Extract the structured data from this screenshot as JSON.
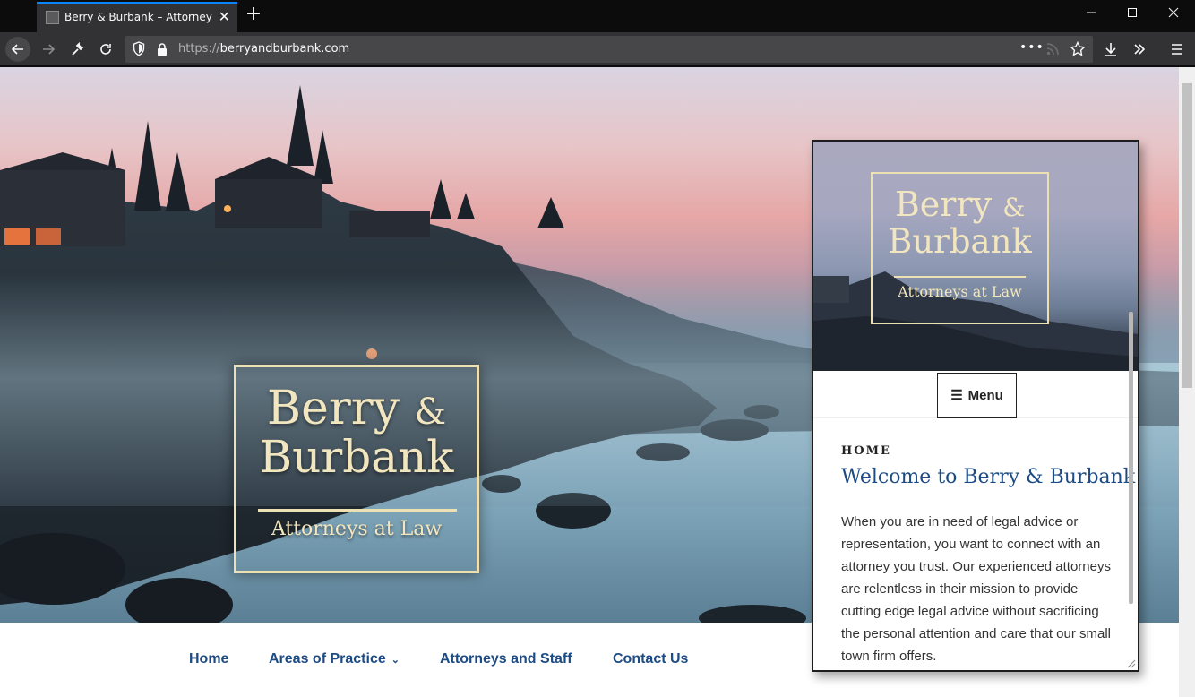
{
  "browser": {
    "tab_title": "Berry & Burbank – Attorneys at Law",
    "tab_close_glyph": "✕",
    "newtab_glyph": "+",
    "url_scheme": "https://",
    "url_host": "berryandburbank.com",
    "url_more_glyph": "•••",
    "icons": [
      "back-arrow-icon",
      "forward-arrow-icon",
      "wrench-icon",
      "reload-icon",
      "shield-icon",
      "lock-icon",
      "page-actions-icon",
      "rss-icon",
      "bookmark-star-icon",
      "download-icon",
      "overflow-chevron-icon",
      "hamburger-menu-icon",
      "minimize-icon",
      "maximize-icon",
      "close-window-icon"
    ]
  },
  "hero": {
    "logo_line1": "Berry",
    "logo_amp": "&",
    "logo_line2": "Burbank",
    "logo_tagline": "Attorneys at Law"
  },
  "nav": {
    "items": [
      {
        "label": "Home"
      },
      {
        "label": "Areas of Practice",
        "dropdown": true
      },
      {
        "label": "Attorneys and Staff"
      },
      {
        "label": "Contact Us"
      }
    ]
  },
  "popup": {
    "logo_line1": "Berry",
    "logo_amp": "&",
    "logo_line2": "Burbank",
    "logo_tagline": "Attorneys at Law",
    "menu_label": "Menu",
    "section_heading": "HOME",
    "title": "Welcome to Berry & Burbank",
    "body": "When you are in need of legal advice or representation, you want to connect with an attorney you trust. Our experienced attorneys are relentless in their mission to provide cutting edge legal advice without sacrificing the personal attention and care that our small town firm offers."
  },
  "colors": {
    "link": "#1d4b84",
    "logo_gold": "#f1e6bf",
    "chrome_dark": "#0c0c0d",
    "toolbar": "#323234",
    "tab_accent": "#0a84ff"
  }
}
